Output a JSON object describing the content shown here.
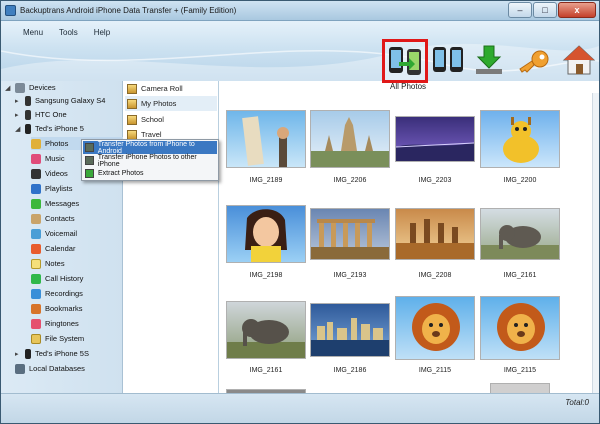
{
  "window": {
    "title": "Backuptrans Android iPhone Data Transfer + (Family Edition)",
    "buttons": [
      "–",
      "□",
      "x"
    ]
  },
  "menu": [
    "Menu",
    "Tools",
    "Help"
  ],
  "toolbar": {
    "section_label": "All Photos",
    "tools": [
      {
        "name": "transfer-iphone-to-android-icon"
      },
      {
        "name": "transfer-phone-to-phone-icon"
      },
      {
        "name": "download-icon"
      },
      {
        "name": "key-icon"
      },
      {
        "name": "home-icon"
      }
    ]
  },
  "tree": {
    "devices_label": "Devices",
    "devices": [
      "Sangsung Galaxy S4",
      "HTC One",
      "Ted's iPhone 5"
    ],
    "iphone_items": [
      "Photos",
      "Music",
      "Videos",
      "Playlists",
      "Messages",
      "Contacts",
      "Voicemail",
      "Calendar",
      "Notes",
      "Call History",
      "Recordings",
      "Bookmarks",
      "Ringtones",
      "File System"
    ],
    "other_device": "Ted's iPhone 5S",
    "local_databases": "Local Databases"
  },
  "albums": [
    "Camera Roll",
    "My Photos",
    "School",
    "Travel"
  ],
  "context_menu": [
    "Transfer Photos from iPhone to Android",
    "Transfer iPhone Photos to other iPhone",
    "Extract Photos"
  ],
  "photos": [
    {
      "caption": "IMG_2189"
    },
    {
      "caption": "IMG_2206"
    },
    {
      "caption": "IMG_2203"
    },
    {
      "caption": "IMG_2200"
    },
    {
      "caption": "IMG_2198"
    },
    {
      "caption": "IMG_2193"
    },
    {
      "caption": "IMG_2208"
    },
    {
      "caption": "IMG_2161"
    },
    {
      "caption": "IMG_2161"
    },
    {
      "caption": "IMG_2186"
    },
    {
      "caption": "IMG_2115"
    },
    {
      "caption": "IMG_2115"
    }
  ],
  "status": {
    "total": "Total:0"
  }
}
